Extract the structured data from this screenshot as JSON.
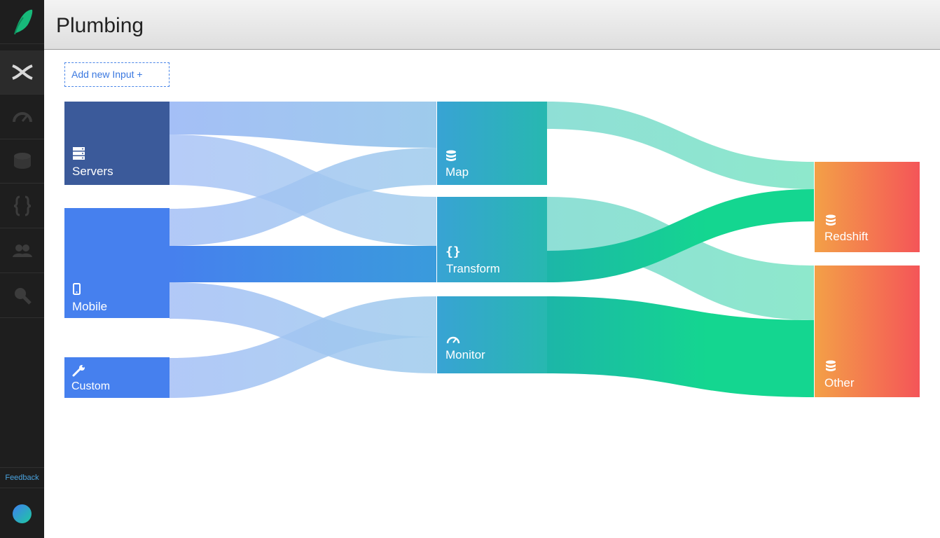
{
  "app": {
    "logo": "leaf-logo-icon"
  },
  "sidebar": {
    "items": [
      {
        "name": "plumbing",
        "icon": "crossed-pipes-icon",
        "active": true
      },
      {
        "name": "monitor",
        "icon": "gauge-icon"
      },
      {
        "name": "database",
        "icon": "database-icon"
      },
      {
        "name": "transform",
        "icon": "braces-icon"
      },
      {
        "name": "users",
        "icon": "users-icon"
      },
      {
        "name": "search",
        "icon": "search-icon"
      }
    ],
    "feedback_label": "Feedback"
  },
  "header": {
    "title": "Plumbing"
  },
  "toolbar": {
    "add_input_label": "Add new Input +"
  },
  "flow": {
    "inputs": [
      {
        "label": "Servers",
        "icon": "server-icon",
        "color": "#3b5a9a"
      },
      {
        "label": "Mobile",
        "icon": "mobile-icon",
        "color": "#4680ee"
      },
      {
        "label": "Custom",
        "icon": "wrench-icon",
        "color": "#4680ee"
      }
    ],
    "processors": [
      {
        "label": "Map",
        "icon": "database-icon"
      },
      {
        "label": "Transform",
        "icon": "braces-icon"
      },
      {
        "label": "Monitor",
        "icon": "gauge-icon"
      }
    ],
    "outputs": [
      {
        "label": "Redshift",
        "icon": "database-icon"
      },
      {
        "label": "Other",
        "icon": "database-icon"
      }
    ],
    "colors": {
      "input_link": "#a4bff6",
      "processor_start": "#38a3d4",
      "processor_end": "#27b8b0",
      "output_start": "#f3a047",
      "output_end": "#f45558",
      "output_link_light": "#8ee8cc",
      "output_link_strong": "#14d690"
    }
  }
}
